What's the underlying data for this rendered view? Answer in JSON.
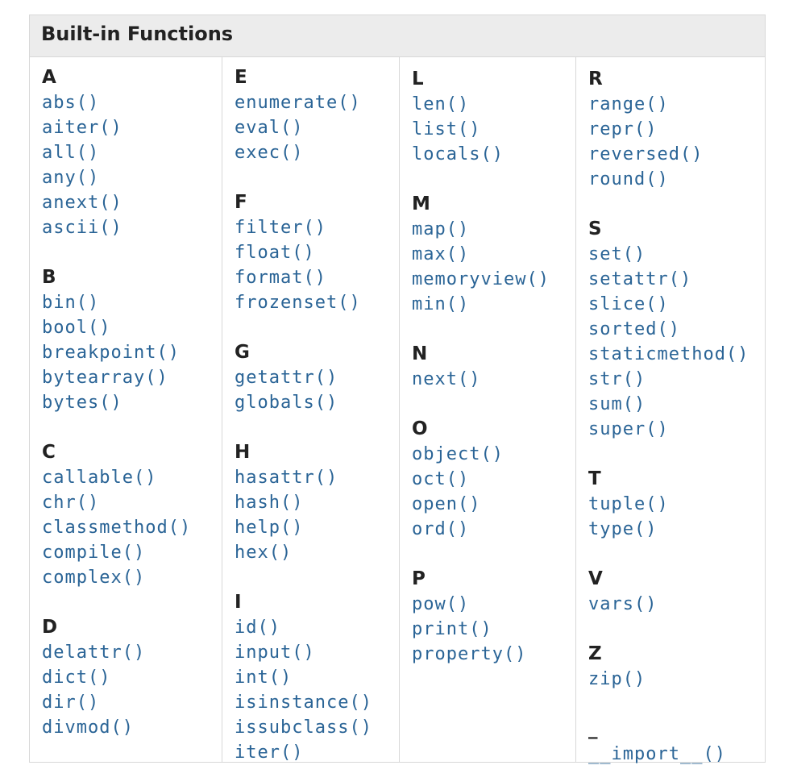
{
  "title": "Built-in Functions",
  "columns": [
    [
      {
        "letter": "A",
        "items": [
          "abs()",
          "aiter()",
          "all()",
          "any()",
          "anext()",
          "ascii()"
        ]
      },
      {
        "letter": "B",
        "items": [
          "bin()",
          "bool()",
          "breakpoint()",
          "bytearray()",
          "bytes()"
        ]
      },
      {
        "letter": "C",
        "items": [
          "callable()",
          "chr()",
          "classmethod()",
          "compile()",
          "complex()"
        ]
      },
      {
        "letter": "D",
        "items": [
          "delattr()",
          "dict()",
          "dir()",
          "divmod()"
        ]
      }
    ],
    [
      {
        "letter": "E",
        "items": [
          "enumerate()",
          "eval()",
          "exec()"
        ]
      },
      {
        "letter": "F",
        "items": [
          "filter()",
          "float()",
          "format()",
          "frozenset()"
        ]
      },
      {
        "letter": "G",
        "items": [
          "getattr()",
          "globals()"
        ]
      },
      {
        "letter": "H",
        "items": [
          "hasattr()",
          "hash()",
          "help()",
          "hex()"
        ]
      },
      {
        "letter": "I",
        "items": [
          "id()",
          "input()",
          "int()",
          "isinstance()",
          "issubclass()",
          "iter()"
        ]
      }
    ],
    [
      {
        "letter": "L",
        "items": [
          "len()",
          "list()",
          "locals()"
        ]
      },
      {
        "letter": "M",
        "items": [
          "map()",
          "max()",
          "memoryview()",
          "min()"
        ]
      },
      {
        "letter": "N",
        "items": [
          "next()"
        ]
      },
      {
        "letter": "O",
        "items": [
          "object()",
          "oct()",
          "open()",
          "ord()"
        ]
      },
      {
        "letter": "P",
        "items": [
          "pow()",
          "print()",
          "property()"
        ]
      }
    ],
    [
      {
        "letter": "R",
        "items": [
          "range()",
          "repr()",
          "reversed()",
          "round()"
        ]
      },
      {
        "letter": "S",
        "items": [
          "set()",
          "setattr()",
          "slice()",
          "sorted()",
          "staticmethod()",
          "str()",
          "sum()",
          "super()"
        ]
      },
      {
        "letter": "T",
        "items": [
          "tuple()",
          "type()"
        ]
      },
      {
        "letter": "V",
        "items": [
          "vars()"
        ]
      },
      {
        "letter": "Z",
        "items": [
          "zip()"
        ]
      },
      {
        "letter": "_",
        "items": [
          "__import__()"
        ]
      }
    ]
  ]
}
